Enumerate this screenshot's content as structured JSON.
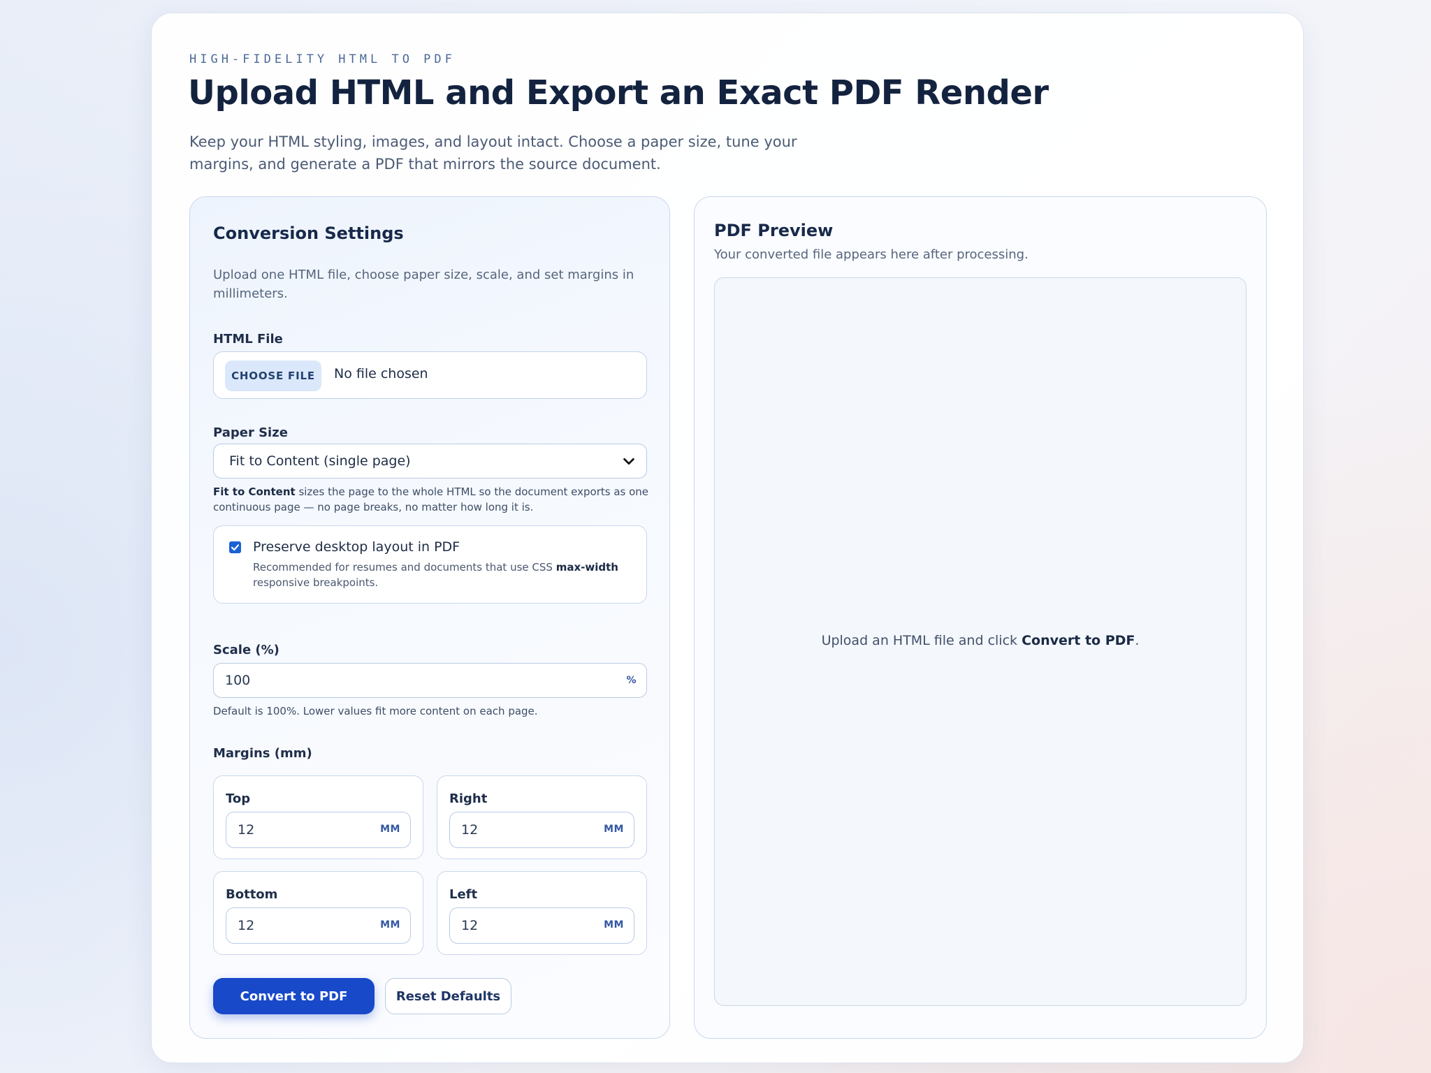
{
  "header": {
    "eyebrow": "HIGH-FIDELITY HTML TO PDF",
    "title": "Upload HTML and Export an Exact PDF Render",
    "subtitle": "Keep your HTML styling, images, and layout intact. Choose a paper size, tune your margins, and generate a PDF that mirrors the source document."
  },
  "settings": {
    "title": "Conversion Settings",
    "description": "Upload one HTML file, choose paper size, scale, and set margins in millimeters.",
    "html_file": {
      "label": "HTML File",
      "button": "CHOOSE FILE",
      "status": "No file chosen"
    },
    "paper_size": {
      "label": "Paper Size",
      "value": "Fit to Content (single page)",
      "hint_bold": "Fit to Content",
      "hint_rest": " sizes the page to the whole HTML so the document exports as one continuous page — no page breaks, no matter how long it is."
    },
    "preserve_layout": {
      "checked": true,
      "label": "Preserve desktop layout in PDF",
      "desc_pre": "Recommended for resumes and documents that use CSS ",
      "desc_bold": "max-width",
      "desc_post": " responsive breakpoints."
    },
    "scale": {
      "label": "Scale (%)",
      "value": "100",
      "unit": "%",
      "hint": "Default is 100%. Lower values fit more content on each page."
    },
    "margins": {
      "label": "Margins (mm)",
      "unit": "MM",
      "top": {
        "label": "Top",
        "value": "12"
      },
      "right": {
        "label": "Right",
        "value": "12"
      },
      "bottom": {
        "label": "Bottom",
        "value": "12"
      },
      "left": {
        "label": "Left",
        "value": "12"
      }
    },
    "buttons": {
      "convert": "Convert to PDF",
      "reset": "Reset Defaults"
    }
  },
  "preview": {
    "title": "PDF Preview",
    "description": "Your converted file appears here after processing.",
    "empty_pre": "Upload an HTML file and click ",
    "empty_bold": "Convert to PDF",
    "empty_post": "."
  },
  "colors": {
    "primary": "#1849c9",
    "checkbox": "#1b62d4",
    "unit": "#3458a3"
  }
}
